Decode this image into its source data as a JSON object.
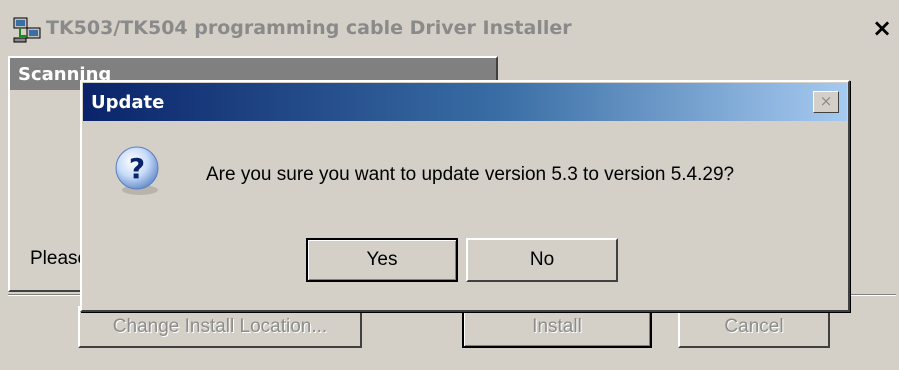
{
  "main_window": {
    "title": "TK503/TK504 programming cable Driver Installer",
    "close_glyph": "×",
    "scan_panel": {
      "header": "Scanning",
      "status_text": "Please"
    },
    "buttons": {
      "change_location": "Change Install Location...",
      "install": "Install",
      "cancel": "Cancel"
    }
  },
  "dialog": {
    "title": "Update",
    "close_glyph": "×",
    "icon": "question-icon",
    "message": "Are you sure you want to update version 5.3 to version 5.4.29?",
    "buttons": {
      "yes": "Yes",
      "no": "No"
    }
  },
  "colors": {
    "titlebar_start": "#0a246a",
    "titlebar_end": "#a6caf0",
    "window_bg": "#d4d0c8"
  }
}
